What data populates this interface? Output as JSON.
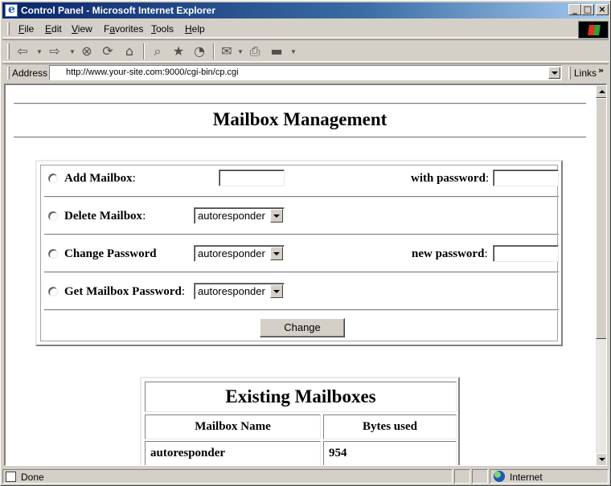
{
  "window": {
    "title": "Control Panel - Microsoft Internet Explorer"
  },
  "menu": [
    {
      "label": "File",
      "key": "F",
      "rest": "ile"
    },
    {
      "label": "Edit",
      "key": "E",
      "rest": "dit"
    },
    {
      "label": "View",
      "key": "V",
      "rest": "iew"
    },
    {
      "label": "Favorites",
      "key": "a",
      "pre": "F",
      "rest": "vorites"
    },
    {
      "label": "Tools",
      "key": "T",
      "rest": "ools"
    },
    {
      "label": "Help",
      "key": "H",
      "rest": "elp"
    }
  ],
  "address": {
    "label": "Address",
    "url": "http://www.your-site.com:9000/cgi-bin/cp.cgi",
    "links_label": "Links"
  },
  "page": {
    "title": "Mailbox Management",
    "form": {
      "add": {
        "label": "Add Mailbox",
        "password_label": "with password",
        "name_value": "",
        "password_value": ""
      },
      "delete": {
        "label": "Delete Mailbox",
        "selected": "autoresponder"
      },
      "change": {
        "label": "Change Password",
        "selected": "autoresponder",
        "password_label": "new password",
        "password_value": ""
      },
      "get": {
        "label": "Get Mailbox Password",
        "selected": "autoresponder"
      },
      "submit_label": "Change",
      "colon": ":"
    },
    "mailboxes": {
      "title": "Existing Mailboxes",
      "headers": [
        "Mailbox Name",
        "Bytes used"
      ],
      "rows": [
        [
          "autoresponder",
          "954"
        ]
      ]
    }
  },
  "status": {
    "text": "Done",
    "zone": "Internet"
  },
  "icons": {
    "back": "back-arrow-icon",
    "forward": "forward-arrow-icon",
    "stop": "stop-icon",
    "refresh": "refresh-icon",
    "home": "home-icon",
    "search": "search-icon",
    "favorites": "favorites-icon",
    "history": "history-icon",
    "mail": "mail-icon",
    "print": "print-icon",
    "edit": "edit-icon"
  }
}
